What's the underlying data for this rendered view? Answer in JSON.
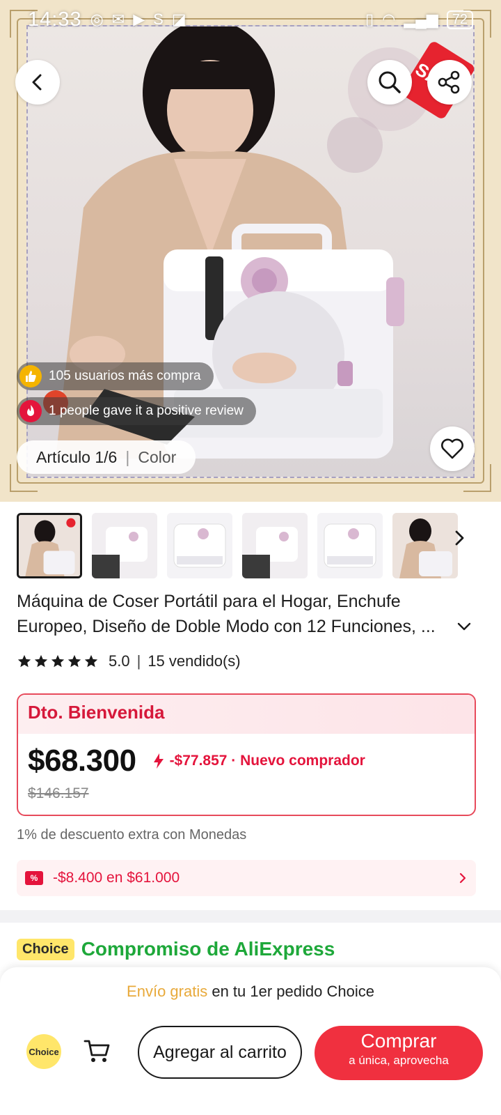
{
  "status_bar": {
    "time": "14:33",
    "battery": "72"
  },
  "hero": {
    "sale_tag": "SALE",
    "badge_buyers": "105 usuarios más compra",
    "badge_reviews": "1 people gave it a positive review",
    "article_counter": "Artículo 1/6",
    "article_color": "Color"
  },
  "product": {
    "title": "Máquina de Coser Portátil para el Hogar, Enchufe Europeo, Diseño de Doble Modo con 12 Funciones, ...",
    "rating": "5.0",
    "sold": "15 vendido(s)"
  },
  "price_card": {
    "header": "Dto. Bienvenida",
    "price": "$68.300",
    "discount": "-$77.857 · Nuevo comprador",
    "original_price": "$146.157"
  },
  "coins_note": "1% de descuento extra con Monedas",
  "coupon": {
    "text": "-$8.400 en $61.000"
  },
  "choice": {
    "badge": "Choice",
    "title": "Compromiso de AliExpress"
  },
  "bottom_bar": {
    "ship_free": "Envío gratis",
    "ship_rest": " en tu 1er pedido Choice",
    "choice_label": "Choice",
    "add_to_cart": "Agregar al carrito",
    "buy": "Comprar",
    "buy_sub": "a única, aprovecha"
  },
  "colors": {
    "accent_red": "#f0303f",
    "choice_green": "#1ea83a",
    "choice_yellow": "#ffe66a"
  }
}
